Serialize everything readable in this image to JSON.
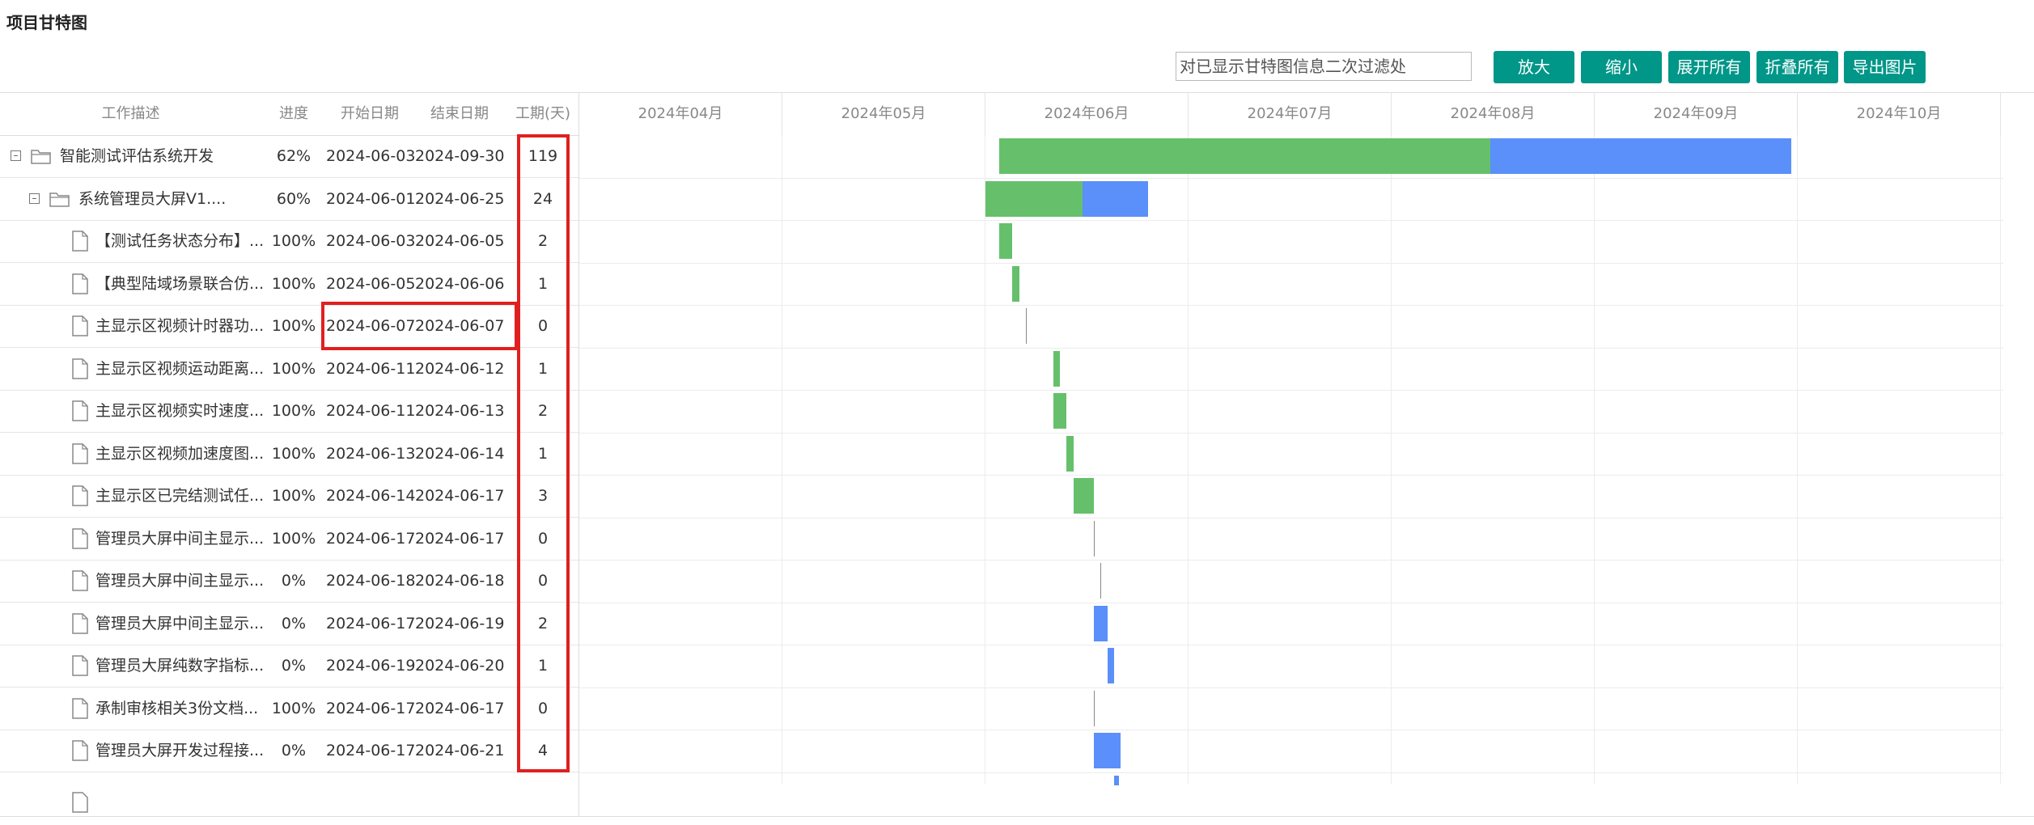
{
  "title": "项目甘特图",
  "toolbar": {
    "filter_placeholder": "对已显示甘特图信息二次过滤处",
    "zoom_in": "放大",
    "zoom_out": "缩小",
    "expand_all": "展开所有",
    "collapse_all": "折叠所有",
    "export_image": "导出图片"
  },
  "columns": {
    "desc": "工作描述",
    "progress": "进度",
    "start": "开始日期",
    "end": "结束日期",
    "duration": "工期(天)"
  },
  "months": [
    "2024年04月",
    "2024年05月",
    "2024年06月",
    "2024年07月",
    "2024年08月",
    "2024年09月",
    "2024年10月"
  ],
  "tasks": [
    {
      "name": "智能测试评估系统开发",
      "progress": "62%",
      "start": "2024-06-03",
      "end": "2024-09-30",
      "duration": "119",
      "level": 0,
      "type": "folder",
      "pct": 0.62
    },
    {
      "name": "系统管理员大屏V1....",
      "progress": "60%",
      "start": "2024-06-01",
      "end": "2024-06-25",
      "duration": "24",
      "level": 1,
      "type": "folder",
      "pct": 0.6
    },
    {
      "name": "【测试任务状态分布】...",
      "progress": "100%",
      "start": "2024-06-03",
      "end": "2024-06-05",
      "duration": "2",
      "level": 2,
      "type": "file",
      "pct": 1
    },
    {
      "name": "【典型陆域场景联合仿...",
      "progress": "100%",
      "start": "2024-06-05",
      "end": "2024-06-06",
      "duration": "1",
      "level": 2,
      "type": "file",
      "pct": 1
    },
    {
      "name": "主显示区视频计时器功...",
      "progress": "100%",
      "start": "2024-06-07",
      "end": "2024-06-07",
      "duration": "0",
      "level": 2,
      "type": "file",
      "pct": 1
    },
    {
      "name": "主显示区视频运动距离...",
      "progress": "100%",
      "start": "2024-06-11",
      "end": "2024-06-12",
      "duration": "1",
      "level": 2,
      "type": "file",
      "pct": 1
    },
    {
      "name": "主显示区视频实时速度...",
      "progress": "100%",
      "start": "2024-06-11",
      "end": "2024-06-13",
      "duration": "2",
      "level": 2,
      "type": "file",
      "pct": 1
    },
    {
      "name": "主显示区视频加速度图...",
      "progress": "100%",
      "start": "2024-06-13",
      "end": "2024-06-14",
      "duration": "1",
      "level": 2,
      "type": "file",
      "pct": 1
    },
    {
      "name": "主显示区已完结测试任...",
      "progress": "100%",
      "start": "2024-06-14",
      "end": "2024-06-17",
      "duration": "3",
      "level": 2,
      "type": "file",
      "pct": 1
    },
    {
      "name": "管理员大屏中间主显示...",
      "progress": "100%",
      "start": "2024-06-17",
      "end": "2024-06-17",
      "duration": "0",
      "level": 2,
      "type": "file",
      "pct": 1
    },
    {
      "name": "管理员大屏中间主显示...",
      "progress": "0%",
      "start": "2024-06-18",
      "end": "2024-06-18",
      "duration": "0",
      "level": 2,
      "type": "file",
      "pct": 0
    },
    {
      "name": "管理员大屏中间主显示...",
      "progress": "0%",
      "start": "2024-06-17",
      "end": "2024-06-19",
      "duration": "2",
      "level": 2,
      "type": "file",
      "pct": 0
    },
    {
      "name": "管理员大屏纯数字指标...",
      "progress": "0%",
      "start": "2024-06-19",
      "end": "2024-06-20",
      "duration": "1",
      "level": 2,
      "type": "file",
      "pct": 0
    },
    {
      "name": "承制审核相关3份文档...",
      "progress": "100%",
      "start": "2024-06-17",
      "end": "2024-06-17",
      "duration": "0",
      "level": 2,
      "type": "file",
      "pct": 1
    },
    {
      "name": "管理员大屏开发过程接...",
      "progress": "0%",
      "start": "2024-06-17",
      "end": "2024-06-21",
      "duration": "4",
      "level": 2,
      "type": "file",
      "pct": 0
    }
  ],
  "colors": {
    "toolbar_button": "#009688",
    "bar_done": "#66c06b",
    "bar_todo": "#5b8ff9",
    "highlight_box": "#e02020"
  }
}
